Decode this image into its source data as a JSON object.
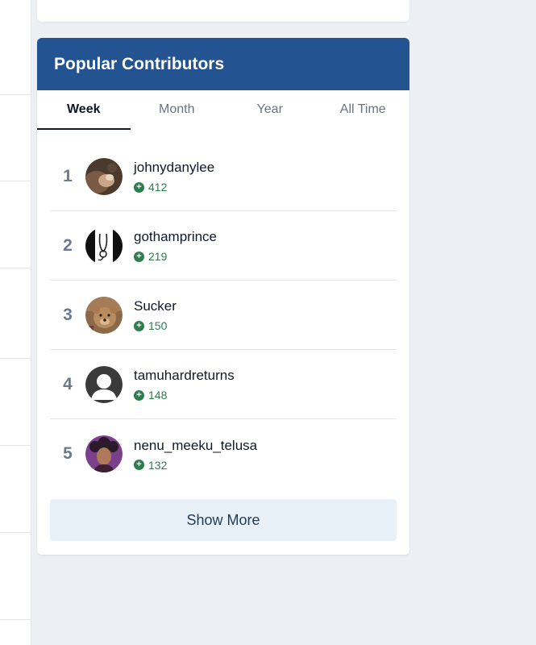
{
  "widget": {
    "title": "Popular Contributors",
    "tabs": [
      {
        "label": "Week",
        "active": true
      },
      {
        "label": "Month",
        "active": false
      },
      {
        "label": "Year",
        "active": false
      },
      {
        "label": "All Time",
        "active": false
      }
    ],
    "contributors": [
      {
        "rank": "1",
        "username": "johnydanylee",
        "score": "412",
        "avatar": "kitten-photo"
      },
      {
        "rank": "2",
        "username": "gothamprince",
        "score": "219",
        "avatar": "stethoscope-drawing"
      },
      {
        "rank": "3",
        "username": "Sucker",
        "score": "150",
        "avatar": "teddy-bear-photo"
      },
      {
        "rank": "4",
        "username": "tamuhardreturns",
        "score": "148",
        "avatar": "default-silhouette"
      },
      {
        "rank": "5",
        "username": "nenu_meeku_telusa",
        "score": "132",
        "avatar": "person-photo"
      }
    ],
    "show_more_label": "Show More"
  },
  "colors": {
    "header_bg": "#235390",
    "score_green": "#2f7d4f",
    "rank_gray": "#6b7a90",
    "button_bg": "#e8f0f8",
    "page_bg": "#eceff4"
  }
}
